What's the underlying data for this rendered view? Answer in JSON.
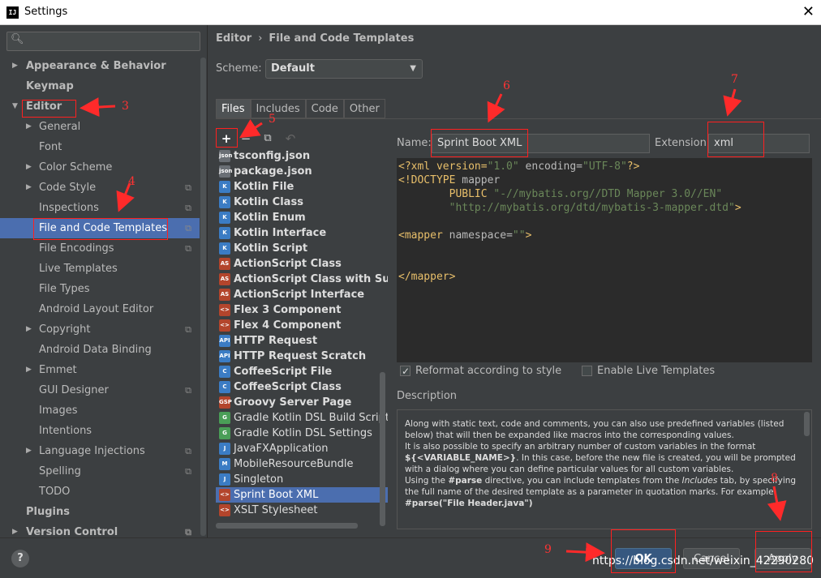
{
  "window": {
    "title": "Settings",
    "close_glyph": "✕"
  },
  "search": {
    "placeholder": "",
    "icon": "search-icon"
  },
  "tree": [
    {
      "label": "Appearance & Behavior",
      "bold": true,
      "arrow": "right",
      "level": 0
    },
    {
      "label": "Keymap",
      "bold": true,
      "level": 0
    },
    {
      "label": "Editor",
      "bold": true,
      "arrow": "down",
      "level": 0
    },
    {
      "label": "General",
      "arrow": "right",
      "level": 1
    },
    {
      "label": "Font",
      "level": 1
    },
    {
      "label": "Color Scheme",
      "arrow": "right",
      "level": 1
    },
    {
      "label": "Code Style",
      "arrow": "right",
      "level": 1,
      "cfg": true
    },
    {
      "label": "Inspections",
      "level": 1,
      "cfg": true
    },
    {
      "label": "File and Code Templates",
      "level": 1,
      "cfg": true,
      "selected": true
    },
    {
      "label": "File Encodings",
      "level": 1,
      "cfg": true
    },
    {
      "label": "Live Templates",
      "level": 1
    },
    {
      "label": "File Types",
      "level": 1
    },
    {
      "label": "Android Layout Editor",
      "level": 1
    },
    {
      "label": "Copyright",
      "arrow": "right",
      "level": 1,
      "cfg": true
    },
    {
      "label": "Android Data Binding",
      "level": 1
    },
    {
      "label": "Emmet",
      "arrow": "right",
      "level": 1
    },
    {
      "label": "GUI Designer",
      "level": 1,
      "cfg": true
    },
    {
      "label": "Images",
      "level": 1
    },
    {
      "label": "Intentions",
      "level": 1
    },
    {
      "label": "Language Injections",
      "arrow": "right",
      "level": 1,
      "cfg": true
    },
    {
      "label": "Spelling",
      "level": 1,
      "cfg": true
    },
    {
      "label": "TODO",
      "level": 1
    },
    {
      "label": "Plugins",
      "bold": true,
      "level": 0
    },
    {
      "label": "Version Control",
      "bold": true,
      "arrow": "right",
      "level": 0,
      "cfg": true
    }
  ],
  "breadcrumb": {
    "parent": "Editor",
    "sep": "›",
    "current": "File and Code Templates"
  },
  "scheme": {
    "label": "Scheme:",
    "value": "Default"
  },
  "tabs": [
    "Files",
    "Includes",
    "Code",
    "Other"
  ],
  "toolbar": {
    "add": "+",
    "remove": "−",
    "copy": "⧉",
    "reset": "↶"
  },
  "templates": [
    {
      "label": "tsconfig.json",
      "bold": true,
      "icon": "json",
      "color": "#6a6f75"
    },
    {
      "label": "package.json",
      "bold": true,
      "icon": "json",
      "color": "#6a6f75"
    },
    {
      "label": "Kotlin File",
      "bold": true,
      "icon": "K",
      "color": "#3b7cc4"
    },
    {
      "label": "Kotlin Class",
      "bold": true,
      "icon": "K",
      "color": "#3b7cc4"
    },
    {
      "label": "Kotlin Enum",
      "bold": true,
      "icon": "K",
      "color": "#3b7cc4"
    },
    {
      "label": "Kotlin Interface",
      "bold": true,
      "icon": "K",
      "color": "#3b7cc4"
    },
    {
      "label": "Kotlin Script",
      "bold": true,
      "icon": "K",
      "color": "#3b7cc4"
    },
    {
      "label": "ActionScript Class",
      "bold": true,
      "icon": "AS",
      "color": "#b3452c"
    },
    {
      "label": "ActionScript Class with Supers",
      "bold": true,
      "icon": "AS",
      "color": "#b3452c"
    },
    {
      "label": "ActionScript Interface",
      "bold": true,
      "icon": "AS",
      "color": "#b3452c"
    },
    {
      "label": "Flex 3 Component",
      "bold": true,
      "icon": "<>",
      "color": "#b3452c"
    },
    {
      "label": "Flex 4 Component",
      "bold": true,
      "icon": "<>",
      "color": "#b3452c"
    },
    {
      "label": "HTTP Request",
      "bold": true,
      "icon": "API",
      "color": "#3b7cc4"
    },
    {
      "label": "HTTP Request Scratch",
      "bold": true,
      "icon": "API",
      "color": "#3b7cc4"
    },
    {
      "label": "CoffeeScript File",
      "bold": true,
      "icon": "C",
      "color": "#3b7cc4"
    },
    {
      "label": "CoffeeScript Class",
      "bold": true,
      "icon": "C",
      "color": "#3b7cc4"
    },
    {
      "label": "Groovy Server Page",
      "bold": true,
      "icon": "GSP",
      "color": "#b3452c"
    },
    {
      "label": "Gradle Kotlin DSL Build Script",
      "bold": false,
      "icon": "G",
      "color": "#4a9e57"
    },
    {
      "label": "Gradle Kotlin DSL Settings",
      "bold": false,
      "icon": "G",
      "color": "#4a9e57"
    },
    {
      "label": "JavaFXApplication",
      "bold": false,
      "icon": "J",
      "color": "#3b7cc4"
    },
    {
      "label": "MobileResourceBundle",
      "bold": false,
      "icon": "M",
      "color": "#3b7cc4"
    },
    {
      "label": "Singleton",
      "bold": false,
      "icon": "J",
      "color": "#3b7cc4"
    },
    {
      "label": "Sprint Boot XML",
      "bold": false,
      "icon": "<>",
      "color": "#b3452c",
      "selected": true
    },
    {
      "label": "XSLT Stylesheet",
      "bold": false,
      "icon": "<>",
      "color": "#b3452c"
    }
  ],
  "name_field": {
    "label": "Name:",
    "value": "Sprint Boot XML"
  },
  "extension_field": {
    "label": "Extension:",
    "value": "xml"
  },
  "code": {
    "line1_a": "<?xml version=",
    "line1_b": "\"1.0\"",
    "line1_c": " encoding=",
    "line1_d": "\"UTF-8\"",
    "line1_e": "?>",
    "line2_a": "<!DOCTYPE ",
    "line2_b": "mapper",
    "line3_a": "        PUBLIC ",
    "line3_b": "\"-//mybatis.org//DTD Mapper 3.0//EN\"",
    "line4": "        \"http://mybatis.org/dtd/mybatis-3-mapper.dtd\"",
    "line4_end": ">",
    "line6_a": "<mapper ",
    "line6_b": "namespace=",
    "line6_c": "\"\"",
    "line6_d": ">",
    "line9": "</mapper>"
  },
  "options": {
    "reformat": "Reformat according to style",
    "live": "Enable Live Templates"
  },
  "description": {
    "label": "Description",
    "p1a": "Along with static text, code and comments, you can also use predefined variables (listed below) that will then be expanded like macros into the corresponding values.",
    "p1b": "It is also possible to specify an arbitrary number of custom variables in the format ",
    "p1c": "${<VARIABLE_NAME>}",
    "p1d": ". In this case, before the new file is created, you will be prompted with a dialog where you can define particular values for all custom variables.",
    "p2a": "Using the ",
    "p2b": "#parse",
    "p2c": " directive, you can include templates from the ",
    "p2d": "Includes",
    "p2e": " tab, by specifying the full name of the desired template as a parameter in quotation marks. For example:",
    "p3": "#parse(\"File Header.java\")"
  },
  "footer": {
    "help": "?",
    "ok": "OK",
    "cancel": "Cancel",
    "apply": "Apply"
  },
  "watermark": "https://blog.csdn.net/weixin_42290280",
  "annotations": [
    "1",
    "2",
    "3",
    "4",
    "5",
    "6",
    "7",
    "8",
    "9"
  ]
}
